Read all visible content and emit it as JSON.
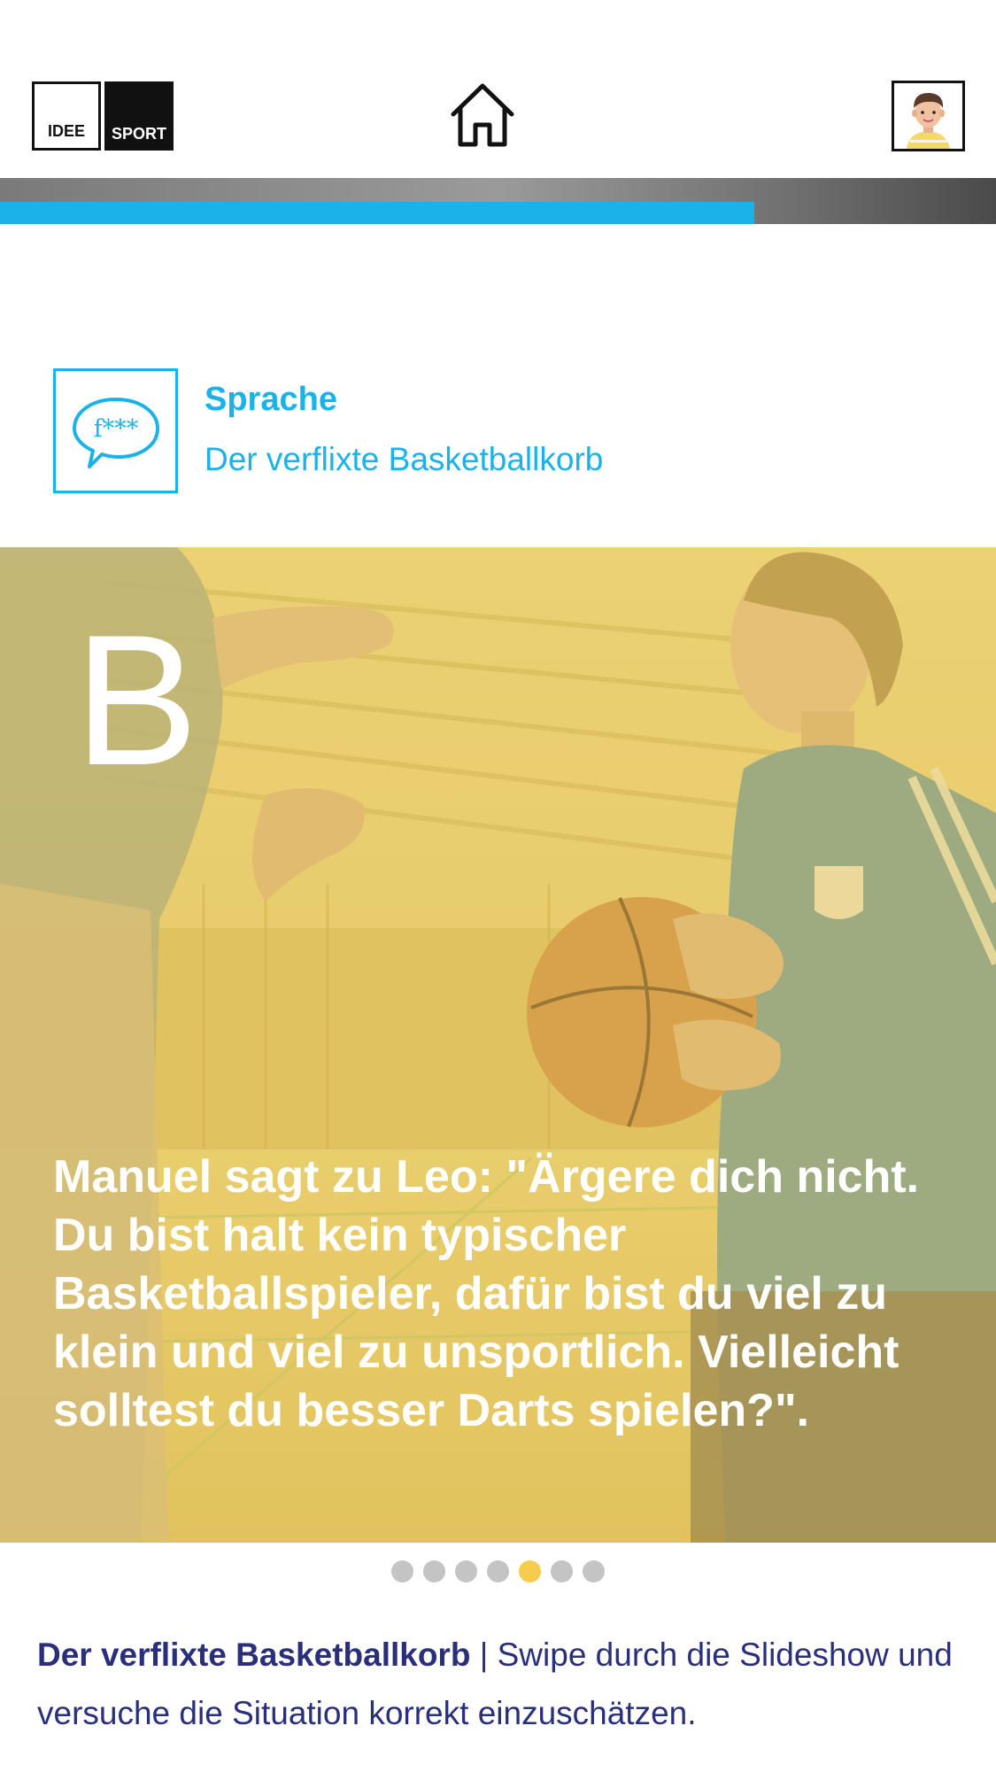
{
  "header": {
    "logo_left": "IDEE",
    "logo_right": "SPORT",
    "home_icon": "home-icon",
    "avatar_icon": "avatar-boy-icon"
  },
  "progress": {
    "fraction": 0.7573,
    "color": "#1ab2e8"
  },
  "category": {
    "icon_text": "f***",
    "title": "Sprache",
    "subtitle": "Der verflixte Basketballkorb"
  },
  "slide": {
    "letter": "B",
    "text": "Manuel sagt zu Leo: \"Ärgere dich nicht. Du bist halt kein typischer Basketballspieler, dafür bist du viel zu klein und viel zu unsportlich. Vielleicht solltest du besser Darts spielen?\".",
    "overlay_color": "#f6cc4e"
  },
  "pagination": {
    "count": 7,
    "active_index": 4,
    "active_color": "#f6cc4e",
    "inactive_color": "#c4c4c4"
  },
  "caption": {
    "title": "Der verflixte Basketballkorb",
    "separator": "|",
    "text": "Swipe durch die Slideshow und versuche die Situation korrekt einzuschätzen."
  }
}
